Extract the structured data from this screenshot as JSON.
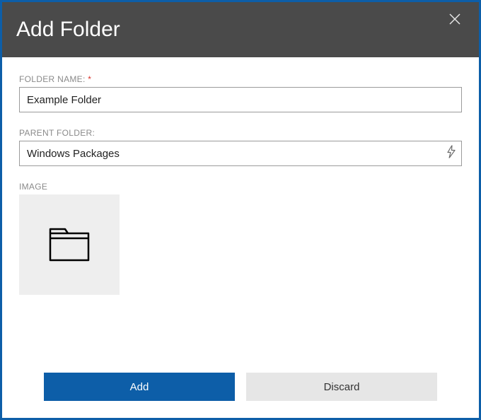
{
  "dialog": {
    "title": "Add Folder"
  },
  "fields": {
    "folder_name": {
      "label": "FOLDER NAME:",
      "required_mark": "*",
      "value": "Example Folder"
    },
    "parent_folder": {
      "label": "PARENT FOLDER:",
      "value": "Windows Packages"
    },
    "image": {
      "label": "IMAGE"
    }
  },
  "buttons": {
    "add": "Add",
    "discard": "Discard"
  },
  "icons": {
    "close": "close-icon",
    "bolt": "lightning-bolt-icon",
    "folder": "folder-icon"
  },
  "colors": {
    "accent": "#0d5ea8",
    "header_bg": "#4a4a4a",
    "label_text": "#8a8a8a",
    "required": "#d9322a",
    "tile_bg": "#eeeeee",
    "secondary_btn": "#e6e6e6"
  }
}
